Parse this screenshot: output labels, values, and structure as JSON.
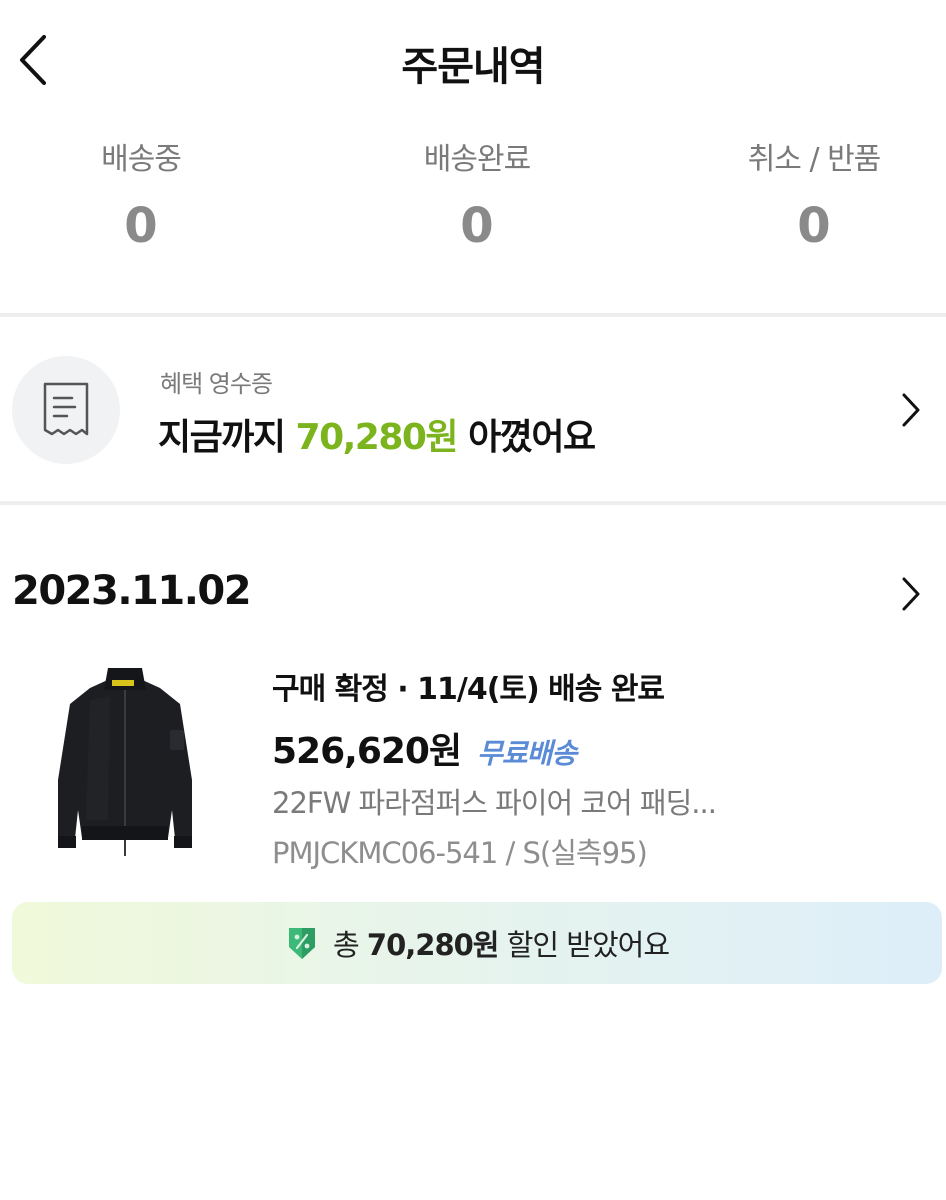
{
  "header": {
    "title": "주문내역",
    "back_icon": "chevron-left-icon"
  },
  "status_summary": [
    {
      "label": "배송중",
      "count": "0"
    },
    {
      "label": "배송완료",
      "count": "0"
    },
    {
      "label": "취소 / 반품",
      "count": "0"
    }
  ],
  "benefit_receipt": {
    "icon": "receipt-icon",
    "subtitle": "혜택 영수증",
    "prefix": "지금까지 ",
    "amount": "70,280원",
    "suffix": " 아꼈어요",
    "accent_color": "#7bb41d"
  },
  "order": {
    "date": "2023.11.02",
    "status": "구매 확정 · 11/4(토) 배송 완료",
    "price": "526,620원",
    "shipping": "무료배송",
    "product_name": "22FW 파라점퍼스 파이어 코어 패딩...",
    "option": "PMJCKMC06-541 / S(실측95)",
    "product_image": "black-bomber-jacket-image"
  },
  "discount": {
    "icon": "discount-badge-icon",
    "prefix": "총 ",
    "amount": "70,280원",
    "suffix": " 할인 받았어요"
  },
  "colors": {
    "accent_green": "#7bb41d",
    "shipping_blue": "#5b8bd6",
    "muted_gray": "#7a7a7a"
  }
}
